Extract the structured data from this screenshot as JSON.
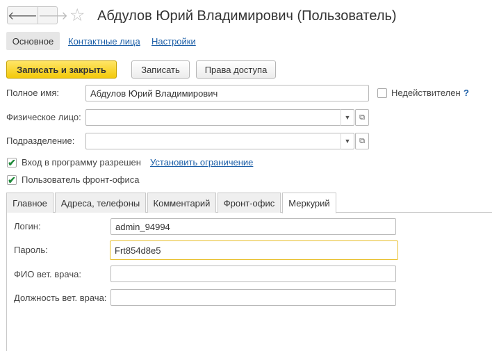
{
  "window": {
    "title": "Абдулов Юрий Владимирович (Пользователь)",
    "back_glyph": "🡐",
    "forward_glyph": "🡒",
    "star_glyph": "☆"
  },
  "top_tabs": {
    "main": "Основное",
    "contacts": "Контактные лица",
    "settings": "Настройки"
  },
  "toolbar": {
    "save_close": "Записать и закрыть",
    "save": "Записать",
    "access_rights": "Права доступа"
  },
  "form": {
    "full_name_label": "Полное имя:",
    "full_name_value": "Абдулов Юрий Владимирович",
    "invalid_label": "Недействителен",
    "help_glyph": "?",
    "person_label": "Физическое лицо:",
    "person_value": "",
    "department_label": "Подразделение:",
    "department_value": "",
    "login_allowed_label": "Вход в программу разрешен",
    "set_restriction_link": "Установить ограничение",
    "front_office_user_label": "Пользователь фронт-офиса",
    "check_glyph": "✔",
    "dropdown_glyph": "▼",
    "open_glyph": "⧉"
  },
  "inner_tabs": [
    "Главное",
    "Адреса, телефоны",
    "Комментарий",
    "Фронт-офис",
    "Меркурий"
  ],
  "mercury": {
    "login_label": "Логин:",
    "login_value": "admin_94994",
    "password_label": "Пароль:",
    "password_value": "Frt854d8e5",
    "vet_name_label": "ФИО вет. врача:",
    "vet_name_value": "",
    "vet_position_label": "Должность вет. врача:",
    "vet_position_value": ""
  },
  "colors": {
    "accent_yellow": "#f3c90a",
    "link_blue": "#1a5da6",
    "check_green": "#1f8a3a",
    "focus_border": "#e8bf2a"
  }
}
